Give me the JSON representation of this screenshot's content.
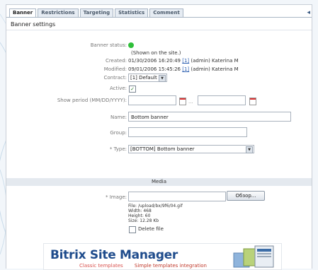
{
  "tabs": [
    "Banner",
    "Restrictions",
    "Targeting",
    "Statistics",
    "Comment"
  ],
  "section_title": "Banner settings",
  "form": {
    "status_label": "Banner status:",
    "status_note": "(Shown on the site.)",
    "created_label": "Created:",
    "created_value": "01/30/2006 16:20:49",
    "created_user_id": "[1]",
    "created_user": "(admin) Katerina M",
    "modified_label": "Modified:",
    "modified_value": "09/01/2006 15:45:26",
    "modified_user_id": "[1]",
    "modified_user": "(admin) Katerina M",
    "contract_label": "Contract:",
    "contract_value": "[1] Default",
    "active_label": "Active:",
    "show_period_label": "Show period (MM/DD/YYYY):",
    "period_separator": "...",
    "name_label": "Name:",
    "name_value": "Bottom banner",
    "group_label": "Group:",
    "group_value": "",
    "type_label": "Type:",
    "type_value": "[BOTTOM] Bottom banner",
    "required_mark": "*"
  },
  "media": {
    "header": "Media",
    "image_label": "Image:",
    "browse_button": "Обзор...",
    "file_lines": [
      "File: /upload/bx/9f6/04.gif",
      "Width: 468",
      "Height: 60",
      "Size: 12.28 Kb"
    ],
    "delete_file_label": "Delete file"
  },
  "preview": {
    "brand": "Bitrix Site Manager",
    "tagline_1": "Classic templates",
    "tagline_2": "Simple templates integration"
  },
  "colors": {
    "status_green": "#2fbf3a",
    "brand_blue": "#1f4c8c",
    "tagline_red": "#c0392b"
  }
}
